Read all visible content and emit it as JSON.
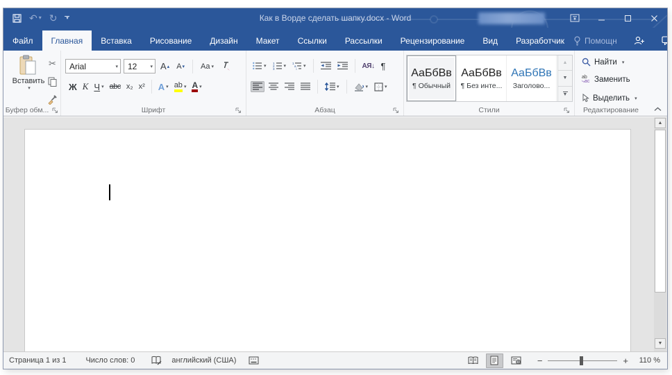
{
  "titlebar": {
    "title": "Как в Ворде сделать шапку.docx  -  Word"
  },
  "tabs": [
    {
      "label": "Файл"
    },
    {
      "label": "Главная"
    },
    {
      "label": "Вставка"
    },
    {
      "label": "Рисование"
    },
    {
      "label": "Дизайн"
    },
    {
      "label": "Макет"
    },
    {
      "label": "Ссылки"
    },
    {
      "label": "Рассылки"
    },
    {
      "label": "Рецензирование"
    },
    {
      "label": "Вид"
    },
    {
      "label": "Разработчик"
    }
  ],
  "assistant": {
    "label": "Помощн"
  },
  "ribbon": {
    "clipboard": {
      "paste": "Вставить",
      "label": "Буфер обм..."
    },
    "font": {
      "name": "Arial",
      "size": "12",
      "grow": "А",
      "shrink": "А",
      "case": "Aa",
      "bold": "Ж",
      "italic": "К",
      "underline": "Ч",
      "strike": "abc",
      "subscript": "x₂",
      "superscript": "x²",
      "effects": "А",
      "highlight": "ab",
      "color": "А",
      "label": "Шрифт"
    },
    "paragraph": {
      "sort": "АЯ↓",
      "pilcrow": "¶",
      "label": "Абзац"
    },
    "styles": {
      "label": "Стили",
      "items": [
        {
          "sample": "АаБбВв",
          "name": "¶ Обычный"
        },
        {
          "sample": "АаБбВв",
          "name": "¶ Без инте..."
        },
        {
          "sample": "АаБбВв",
          "name": "Заголово..."
        }
      ]
    },
    "editing": {
      "find": "Найти",
      "replace": "Заменить",
      "select": "Выделить",
      "label": "Редактирование"
    }
  },
  "statusbar": {
    "page": "Страница 1 из 1",
    "words": "Число слов: 0",
    "language": "английский (США)",
    "zoom": "110 %"
  },
  "colors": {
    "accent": "#2b579a",
    "highlight_yellow": "#ffff00",
    "font_color_red": "#9c0006",
    "heading_blue": "#2e74b5"
  }
}
